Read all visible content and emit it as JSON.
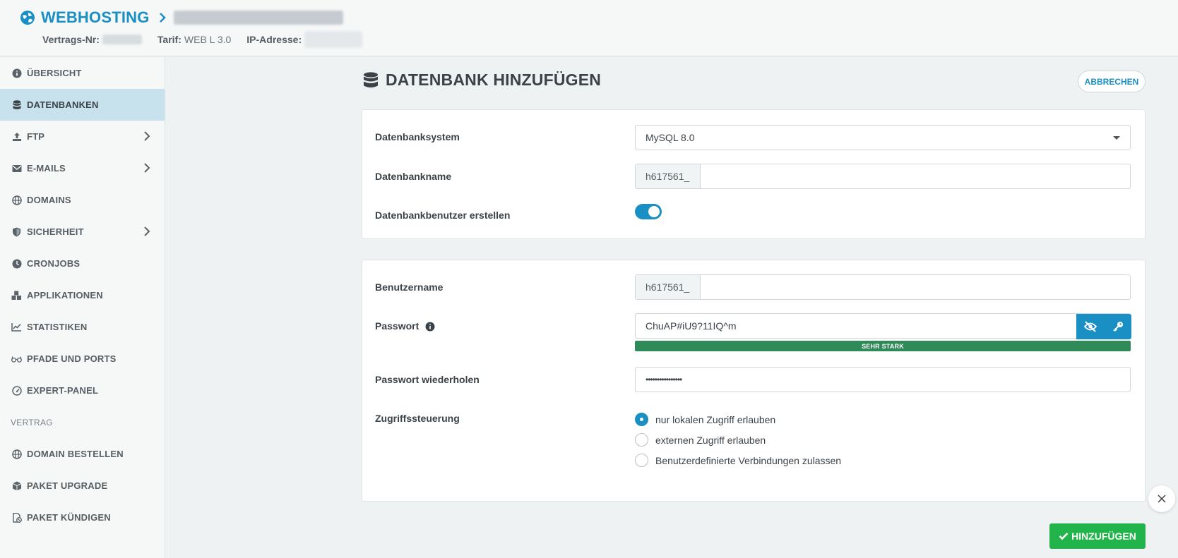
{
  "header": {
    "brand": "WEBHOSTING",
    "contract_label": "Vertrags-Nr:",
    "tariff_label": "Tarif:",
    "tariff_value": "WEB L 3.0",
    "ip_label": "IP-Adresse:"
  },
  "sidebar": {
    "items": [
      {
        "label": "ÜBERSICHT",
        "icon": "info-icon"
      },
      {
        "label": "DATENBANKEN",
        "icon": "database-icon"
      },
      {
        "label": "FTP",
        "icon": "upload-icon"
      },
      {
        "label": "E-MAILS",
        "icon": "envelope-icon"
      },
      {
        "label": "DOMAINS",
        "icon": "globe-icon"
      },
      {
        "label": "SICHERHEIT",
        "icon": "shield-icon"
      },
      {
        "label": "CRONJOBS",
        "icon": "clock-icon"
      },
      {
        "label": "APPLIKATIONEN",
        "icon": "cubes-icon"
      },
      {
        "label": "STATISTIKEN",
        "icon": "chart-line-icon"
      },
      {
        "label": "PFADE UND PORTS",
        "icon": "glasses-icon"
      },
      {
        "label": "EXPERT-PANEL",
        "icon": "gauge-icon"
      }
    ],
    "section_label": "VERTRAG",
    "contract_items": [
      {
        "label": "DOMAIN BESTELLEN",
        "icon": "globe-icon"
      },
      {
        "label": "PAKET UPGRADE",
        "icon": "box-icon"
      },
      {
        "label": "PAKET KÜNDIGEN",
        "icon": "file-cancel-icon"
      }
    ]
  },
  "page": {
    "title": "DATENBANK HINZUFÜGEN",
    "cancel_label": "ABBRECHEN",
    "submit_label": "HINZUFÜGEN"
  },
  "db_card": {
    "system_label": "Datenbanksystem",
    "system_value": "MySQL 8.0",
    "name_label": "Datenbankname",
    "name_prefix": "h617561_",
    "name_value": "",
    "create_user_label": "Datenbankbenutzer erstellen",
    "create_user_on": true
  },
  "user_card": {
    "username_label": "Benutzername",
    "username_prefix": "h617561_",
    "username_value": "",
    "password_label": "Passwort",
    "password_value": "ChuAP#iU9?11IQ^m",
    "strength_label": "SEHR STARK",
    "strength_level": 1.0,
    "repeat_label": "Passwort wiederholen",
    "repeat_value": "••••••••••••••••",
    "access_label": "Zugriffssteuerung",
    "access_options": [
      "nur lokalen Zugriff erlauben",
      "externen Zugriff erlauben",
      "Benutzerdefinierte Verbindungen zulassen"
    ],
    "access_selected": 0
  },
  "colors": {
    "accent": "#1a8fc4",
    "active_nav_bg": "#c7e2ed",
    "strength_bar": "#2e8b57",
    "submit_button": "#22b34a"
  }
}
